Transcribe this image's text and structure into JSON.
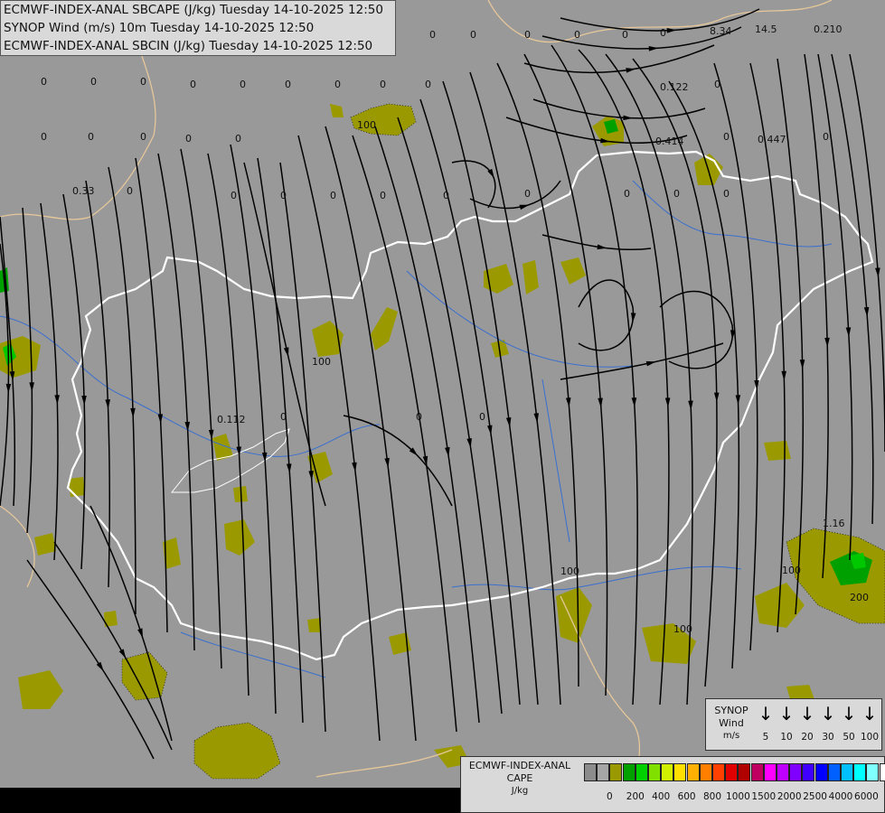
{
  "titles": [
    "ECMWF-INDEX-ANAL SBCAPE (J/kg) Tuesday 14-10-2025 12:50",
    "SYNOP Wind (m/s) 10m Tuesday 14-10-2025 12:50",
    "ECMWF-INDEX-ANAL SBCIN (J/kg) Tuesday 14-10-2025 12:50"
  ],
  "colors": {
    "background": "#999999",
    "cape_low": "#9a9a00",
    "cape_mid": "#00a000",
    "cape_high": "#00c800",
    "border_country": "#ffffff",
    "border_region": "#e6c79a",
    "rivers": "#3a6fcf",
    "streamlines": "#000000"
  },
  "map_values": [
    "0",
    "0",
    "0",
    "0",
    "0",
    "0",
    "8.34",
    "14.5",
    "0.210",
    "0",
    "0",
    "0",
    "0",
    "0",
    "0",
    "0",
    "0",
    "0",
    "0.122",
    "0",
    "0",
    "0",
    "0",
    "0",
    "0",
    "0.414",
    "0",
    "0.447",
    "0",
    "0.33",
    "0",
    "0",
    "0",
    "0",
    "0",
    "0",
    "0",
    "0",
    "0",
    "0",
    "0.112",
    "0",
    "0",
    "0",
    "1.16",
    "100",
    "100",
    "100",
    "100",
    "100",
    "200"
  ],
  "legend_wind": {
    "title_lines": [
      "SYNOP",
      "Wind",
      "m/s"
    ],
    "ticks": [
      "5",
      "10",
      "20",
      "30",
      "50",
      "100"
    ]
  },
  "legend_cape": {
    "title_lines": [
      "ECMWF-INDEX-ANAL",
      "CAPE",
      "J/kg"
    ],
    "colors": [
      "#8c8c8c",
      "#a6a6a6",
      "#9a9a00",
      "#00a000",
      "#00d000",
      "#80e000",
      "#d0f000",
      "#ffe000",
      "#ffb000",
      "#ff8000",
      "#ff4000",
      "#e00000",
      "#b00000",
      "#c00060",
      "#ff00ff",
      "#c000ff",
      "#8000ff",
      "#4000ff",
      "#0000ff",
      "#0060ff",
      "#00c0ff",
      "#00ffff",
      "#80ffff",
      "#ffffff"
    ],
    "ticks": [
      "0",
      "200",
      "400",
      "600",
      "800",
      "1000",
      "1500",
      "2000",
      "2500",
      "4000",
      "6000"
    ]
  }
}
